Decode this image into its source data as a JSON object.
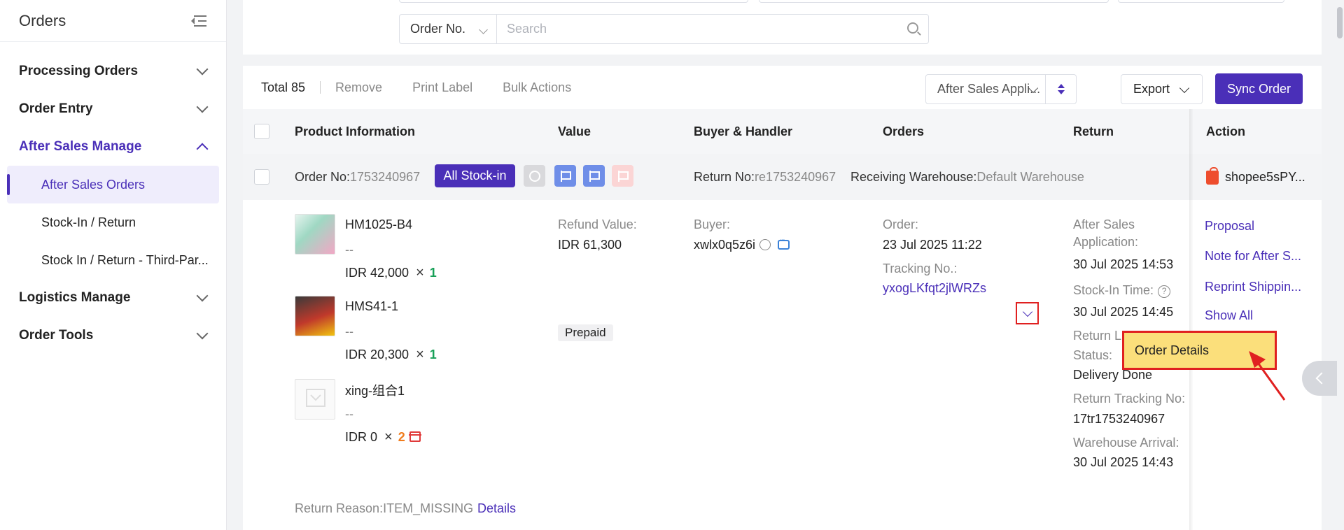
{
  "sidebar": {
    "title": "Orders",
    "items": [
      {
        "label": "Processing Orders"
      },
      {
        "label": "Order Entry"
      },
      {
        "label": "After Sales Manage"
      },
      {
        "label": "Logistics Manage"
      },
      {
        "label": "Order Tools"
      }
    ],
    "sub_items": [
      {
        "label": "After Sales Orders"
      },
      {
        "label": "Stock-In / Return"
      },
      {
        "label": "Stock In / Return - Third-Par..."
      }
    ]
  },
  "filter": {
    "field_select": "Order No.",
    "search_placeholder": "Search"
  },
  "toolbar": {
    "total": "Total 85",
    "remove": "Remove",
    "print_label": "Print Label",
    "bulk_actions": "Bulk Actions",
    "sort_value": "After Sales Appli...",
    "export": "Export",
    "sync": "Sync Order"
  },
  "columns": {
    "product": "Product Information",
    "value": "Value",
    "buyer": "Buyer & Handler",
    "orders": "Orders",
    "return": "Return",
    "action": "Action"
  },
  "order": {
    "order_no_label": "Order No:",
    "order_no": "1753240967",
    "badge": "All Stock-in",
    "return_no_label": "Return No:",
    "return_no": "re1753240967",
    "warehouse_label": "Receiving Warehouse:",
    "warehouse": "Default Warehouse",
    "shop": "shopee5sPY...",
    "products": [
      {
        "sku": "HM1025-B4",
        "variant": "--",
        "price": "IDR 42,000",
        "qty": "1"
      },
      {
        "sku": "HMS41-1",
        "variant": "--",
        "price": "IDR 20,300",
        "qty": "1"
      },
      {
        "sku": "xing-组合1",
        "variant": "--",
        "price": "IDR 0",
        "qty": "2"
      }
    ],
    "refund_label": "Refund Value:",
    "refund_value": "IDR 61,300",
    "payment": "Prepaid",
    "buyer_label": "Buyer:",
    "buyer": "xwlx0q5z6i",
    "order_label": "Order:",
    "order_time": "23 Jul 2025 11:22",
    "tracking_label": "Tracking No.:",
    "tracking": "yxogLKfqt2jlWRZs",
    "after_sales_label_1": "After Sales",
    "after_sales_label_2": "Application:",
    "after_sales_time": "30 Jul 2025 14:53",
    "stockin_label": "Stock-In Time:",
    "stockin_time": "30 Jul 2025 14:45",
    "return_logistics_label_1": "Return L",
    "return_logistics_label_2": "Status:",
    "return_logistics_status": "Delivery Done",
    "return_tracking_label": "Return Tracking No:",
    "return_tracking": "17tr1753240967",
    "warehouse_arrival_label": "Warehouse Arrival:",
    "warehouse_arrival_time": "30 Jul 2025 14:43",
    "return_reason_label": "Return Reason:",
    "return_reason": "ITEM_MISSING",
    "details_link": "Details"
  },
  "actions": {
    "proposal": "Proposal",
    "note": "Note for After S...",
    "reprint": "Reprint Shippin...",
    "show_all": "Show All",
    "dropdown_item": "Order Details"
  },
  "colors": {
    "primary": "#4a2fb8",
    "highlight": "#fbdf7b",
    "annotation_red": "#e02020",
    "shopee": "#ee4d2d"
  }
}
